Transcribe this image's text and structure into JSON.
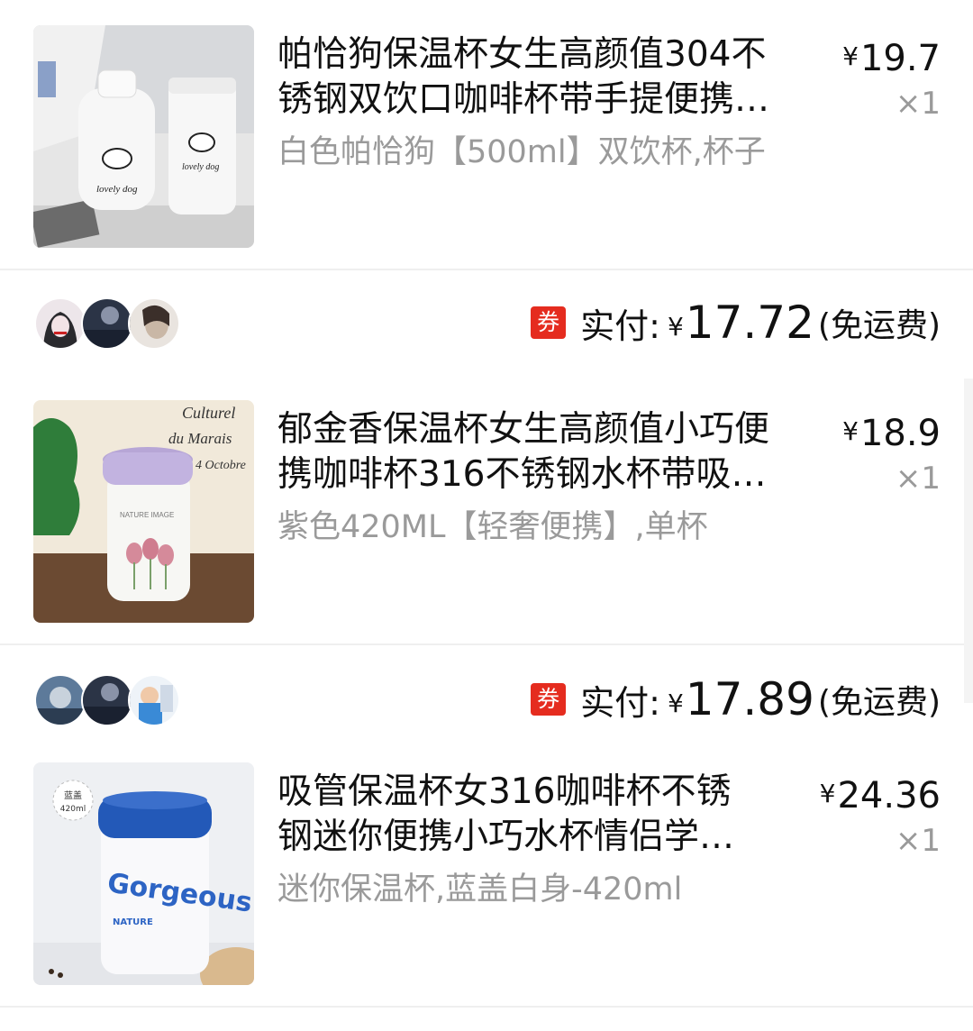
{
  "currency_symbol": "¥",
  "products": [
    {
      "title_line1": "帕恰狗保温杯女生高颜值304不",
      "title_line2": "锈钢双饮口咖啡杯带手提便携…",
      "variant": "白色帕恰狗【500ml】双饮杯,杯子",
      "price": "19.7",
      "qty": "×1"
    },
    {
      "title_line1": "郁金香保温杯女生高颜值小巧便",
      "title_line2": "携咖啡杯316不锈钢水杯带吸…",
      "variant": "紫色420ML【轻奢便携】,单杯",
      "price": "18.9",
      "qty": "×1"
    },
    {
      "title_line1": "吸管保温杯女316咖啡杯不锈",
      "title_line2": "钢迷你便携小巧水杯情侣学…",
      "variant": "迷你保温杯,蓝盖白身-420ml",
      "price": "24.36",
      "qty": "×1"
    }
  ],
  "orders": [
    {
      "coupon_label": "券",
      "paid_label": "实付:",
      "amount": "17.72",
      "shipping_note": "(免运费)"
    },
    {
      "coupon_label": "券",
      "paid_label": "实付:",
      "amount": "17.89",
      "shipping_note": "(免运费)"
    }
  ],
  "image_text": {
    "tulip_bg": [
      "Culturel",
      "du Marais",
      "4 Octobre"
    ],
    "tulip_cup": "NATURE IMAGE",
    "gorgeous_badge": [
      "蓝盖",
      "420ml"
    ],
    "gorgeous_cup": "Gorgeous",
    "gorgeous_sub": "NATURE",
    "pochacco_cup": "lovely dog"
  },
  "colors": {
    "accent_red": "#e52c1f",
    "muted_text": "#9a9a9a",
    "divider": "#efefef"
  }
}
